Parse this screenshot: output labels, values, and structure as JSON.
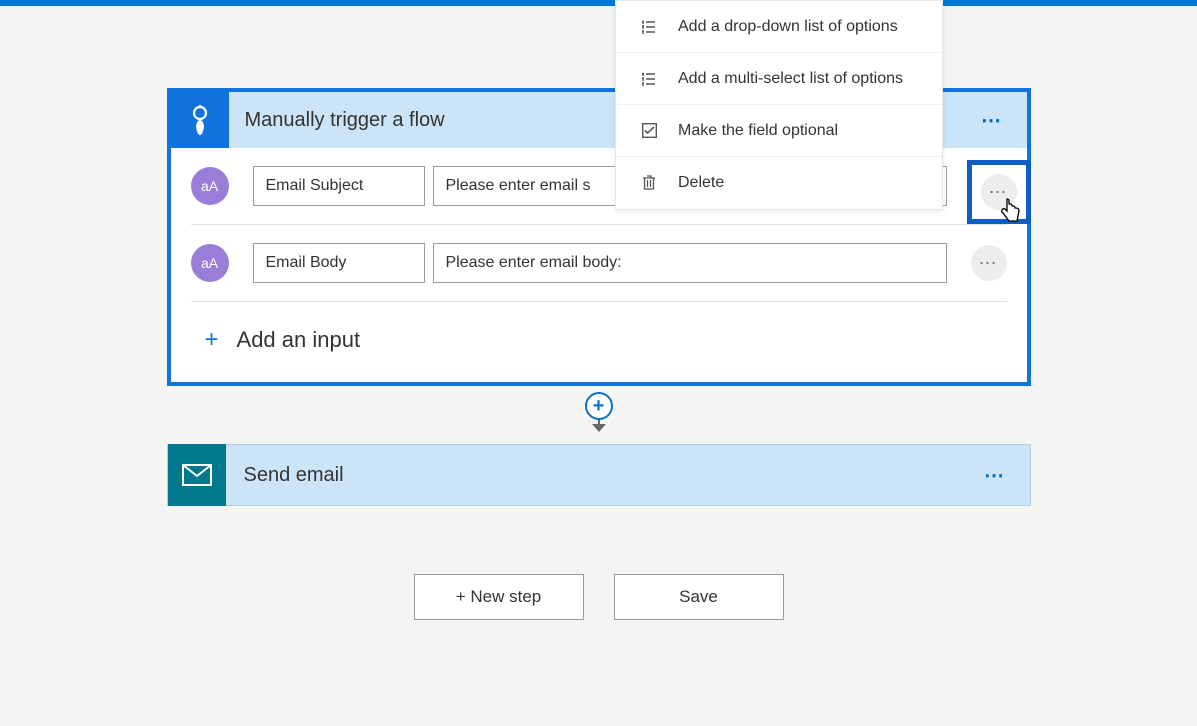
{
  "trigger": {
    "title": "Manually trigger a flow",
    "inputs": [
      {
        "avatar_label": "aA",
        "label": "Email Subject",
        "value": "Please enter email s"
      },
      {
        "avatar_label": "aA",
        "label": "Email Body",
        "value": "Please enter email body:"
      }
    ],
    "add_input_label": "Add an input"
  },
  "menu": {
    "items": [
      {
        "label": "Add a drop-down list of options",
        "icon": "list-numbered-icon"
      },
      {
        "label": "Add a multi-select list of options",
        "icon": "list-numbered-icon"
      },
      {
        "label": "Make the field optional",
        "icon": "checkbox-icon"
      },
      {
        "label": "Delete",
        "icon": "trash-icon"
      }
    ]
  },
  "action": {
    "title": "Send email"
  },
  "buttons": {
    "new_step": "+ New step",
    "save": "Save"
  }
}
